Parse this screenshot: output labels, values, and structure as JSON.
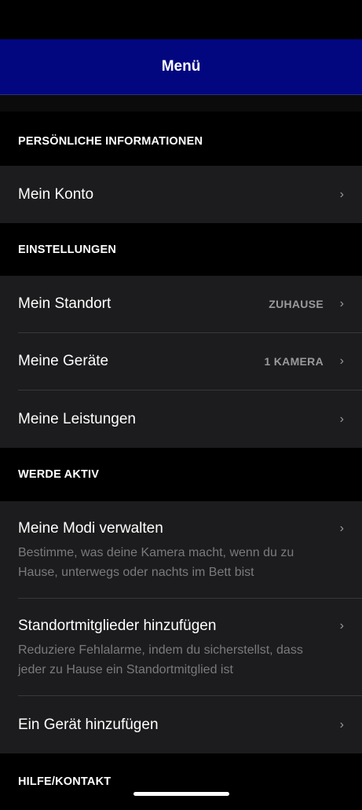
{
  "header": {
    "title": "Menü"
  },
  "sections": [
    {
      "title": "PERSÖNLICHE INFORMATIONEN",
      "items": [
        {
          "label": "Mein Konto"
        }
      ]
    },
    {
      "title": "EINSTELLUNGEN",
      "items": [
        {
          "label": "Mein Standort",
          "value": "ZUHAUSE"
        },
        {
          "label": "Meine Geräte",
          "value": "1 KAMERA"
        },
        {
          "label": "Meine Leistungen"
        }
      ]
    },
    {
      "title": "WERDE AKTIV",
      "items": [
        {
          "label": "Meine Modi verwalten",
          "description": "Bestimme, was deine Kamera macht, wenn du zu Hause, unterwegs oder nachts im Bett bist"
        },
        {
          "label": "Standortmitglieder hinzufügen",
          "description": "Reduziere Fehlalarme, indem du sicherstellst, dass jeder zu Hause ein Standortmitglied ist"
        },
        {
          "label": "Ein Gerät hinzufügen"
        }
      ]
    },
    {
      "title": "HILFE/KONTAKT"
    }
  ],
  "icons": {
    "chevron": "chevron-right-icon"
  },
  "colors": {
    "header_bg": "#020780",
    "row_bg": "#1c1c1e",
    "secondary_text": "#9a9a9e"
  }
}
